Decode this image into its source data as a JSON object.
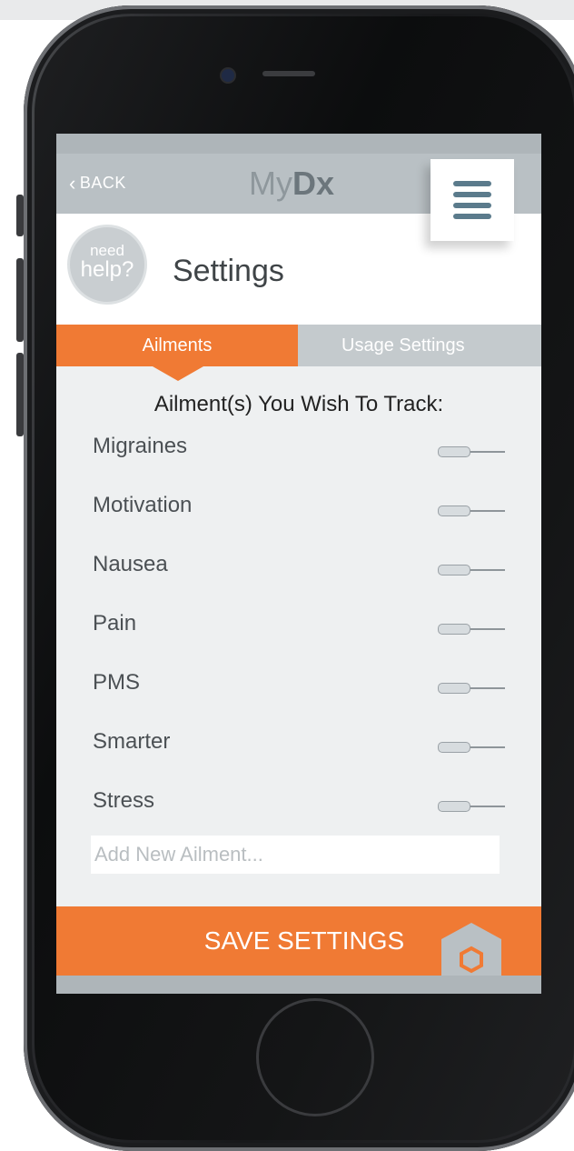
{
  "header": {
    "back_label": "BACK",
    "logo_my": "My",
    "logo_dx": "Dx"
  },
  "help": {
    "line1": "need",
    "line2": "help?"
  },
  "page": {
    "title": "Settings"
  },
  "tabs": [
    {
      "label": "Ailments",
      "active": true
    },
    {
      "label": "Usage Settings",
      "active": false
    }
  ],
  "track_heading": {
    "part1": "Ailment(s)",
    "part2": "You Wish To Track:"
  },
  "ailments": [
    {
      "label": "Migraines",
      "enabled": false
    },
    {
      "label": "Motivation",
      "enabled": false
    },
    {
      "label": "Nausea",
      "enabled": false
    },
    {
      "label": "Pain",
      "enabled": false
    },
    {
      "label": "PMS",
      "enabled": false
    },
    {
      "label": "Smarter",
      "enabled": false
    },
    {
      "label": "Stress",
      "enabled": false
    }
  ],
  "add_ailment": {
    "placeholder": "Add New Ailment...",
    "value": ""
  },
  "save": {
    "label": "SAVE SETTINGS"
  },
  "colors": {
    "accent": "#f07a34",
    "header_gray": "#b9c0c4",
    "menu_icon": "#5b7b8c"
  },
  "icons": {
    "back": "chevron-left-icon",
    "menu": "hamburger-menu-icon",
    "save": "hexagon-icon"
  }
}
